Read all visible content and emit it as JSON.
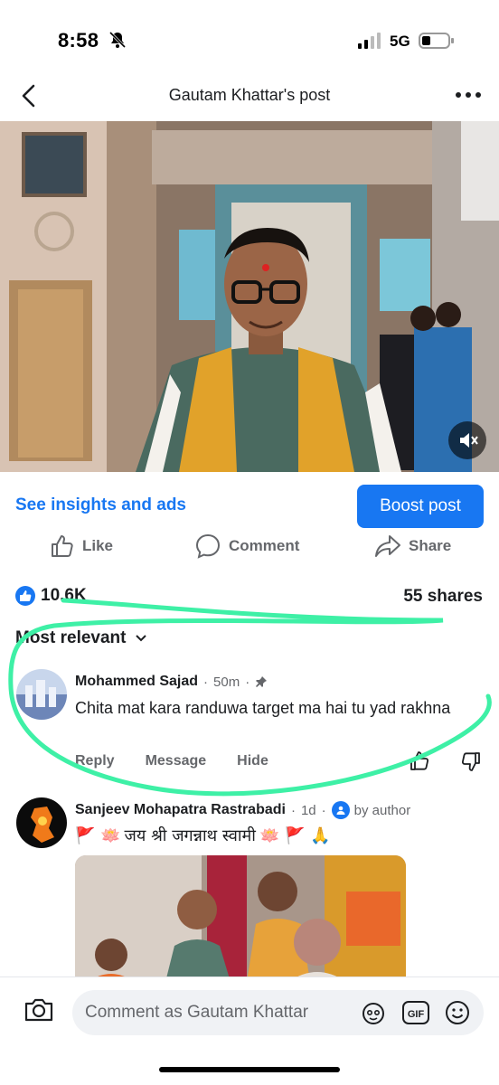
{
  "status_bar": {
    "time": "8:58",
    "network": "5G"
  },
  "header": {
    "title": "Gautam Khattar's post"
  },
  "post": {
    "insights_label": "See insights and ads",
    "boost_label": "Boost post",
    "actions": {
      "like": "Like",
      "comment": "Comment",
      "share": "Share"
    },
    "reactions_count": "10.6K",
    "shares_count": "55 shares"
  },
  "sort": {
    "label": "Most relevant"
  },
  "comments": [
    {
      "author": "Mohammed Sajad",
      "time": "50m",
      "text": "Chita mat kara randuwa target ma hai tu yad rakhna",
      "actions": {
        "reply": "Reply",
        "message": "Message",
        "hide": "Hide"
      }
    },
    {
      "author": "Sanjeev Mohapatra Rastrabadi",
      "time": "1d",
      "badge": "by author",
      "text": "जय श्री जगन्नाथ स्वामी",
      "emoji_prefix": "🚩 🪷",
      "emoji_suffix": "🪷 🚩 🙏"
    }
  ],
  "composer": {
    "placeholder": "Comment as Gautam Khattar",
    "gif_label": "GIF"
  },
  "colors": {
    "accent": "#1877f2",
    "annotation": "#3ef0a6"
  }
}
